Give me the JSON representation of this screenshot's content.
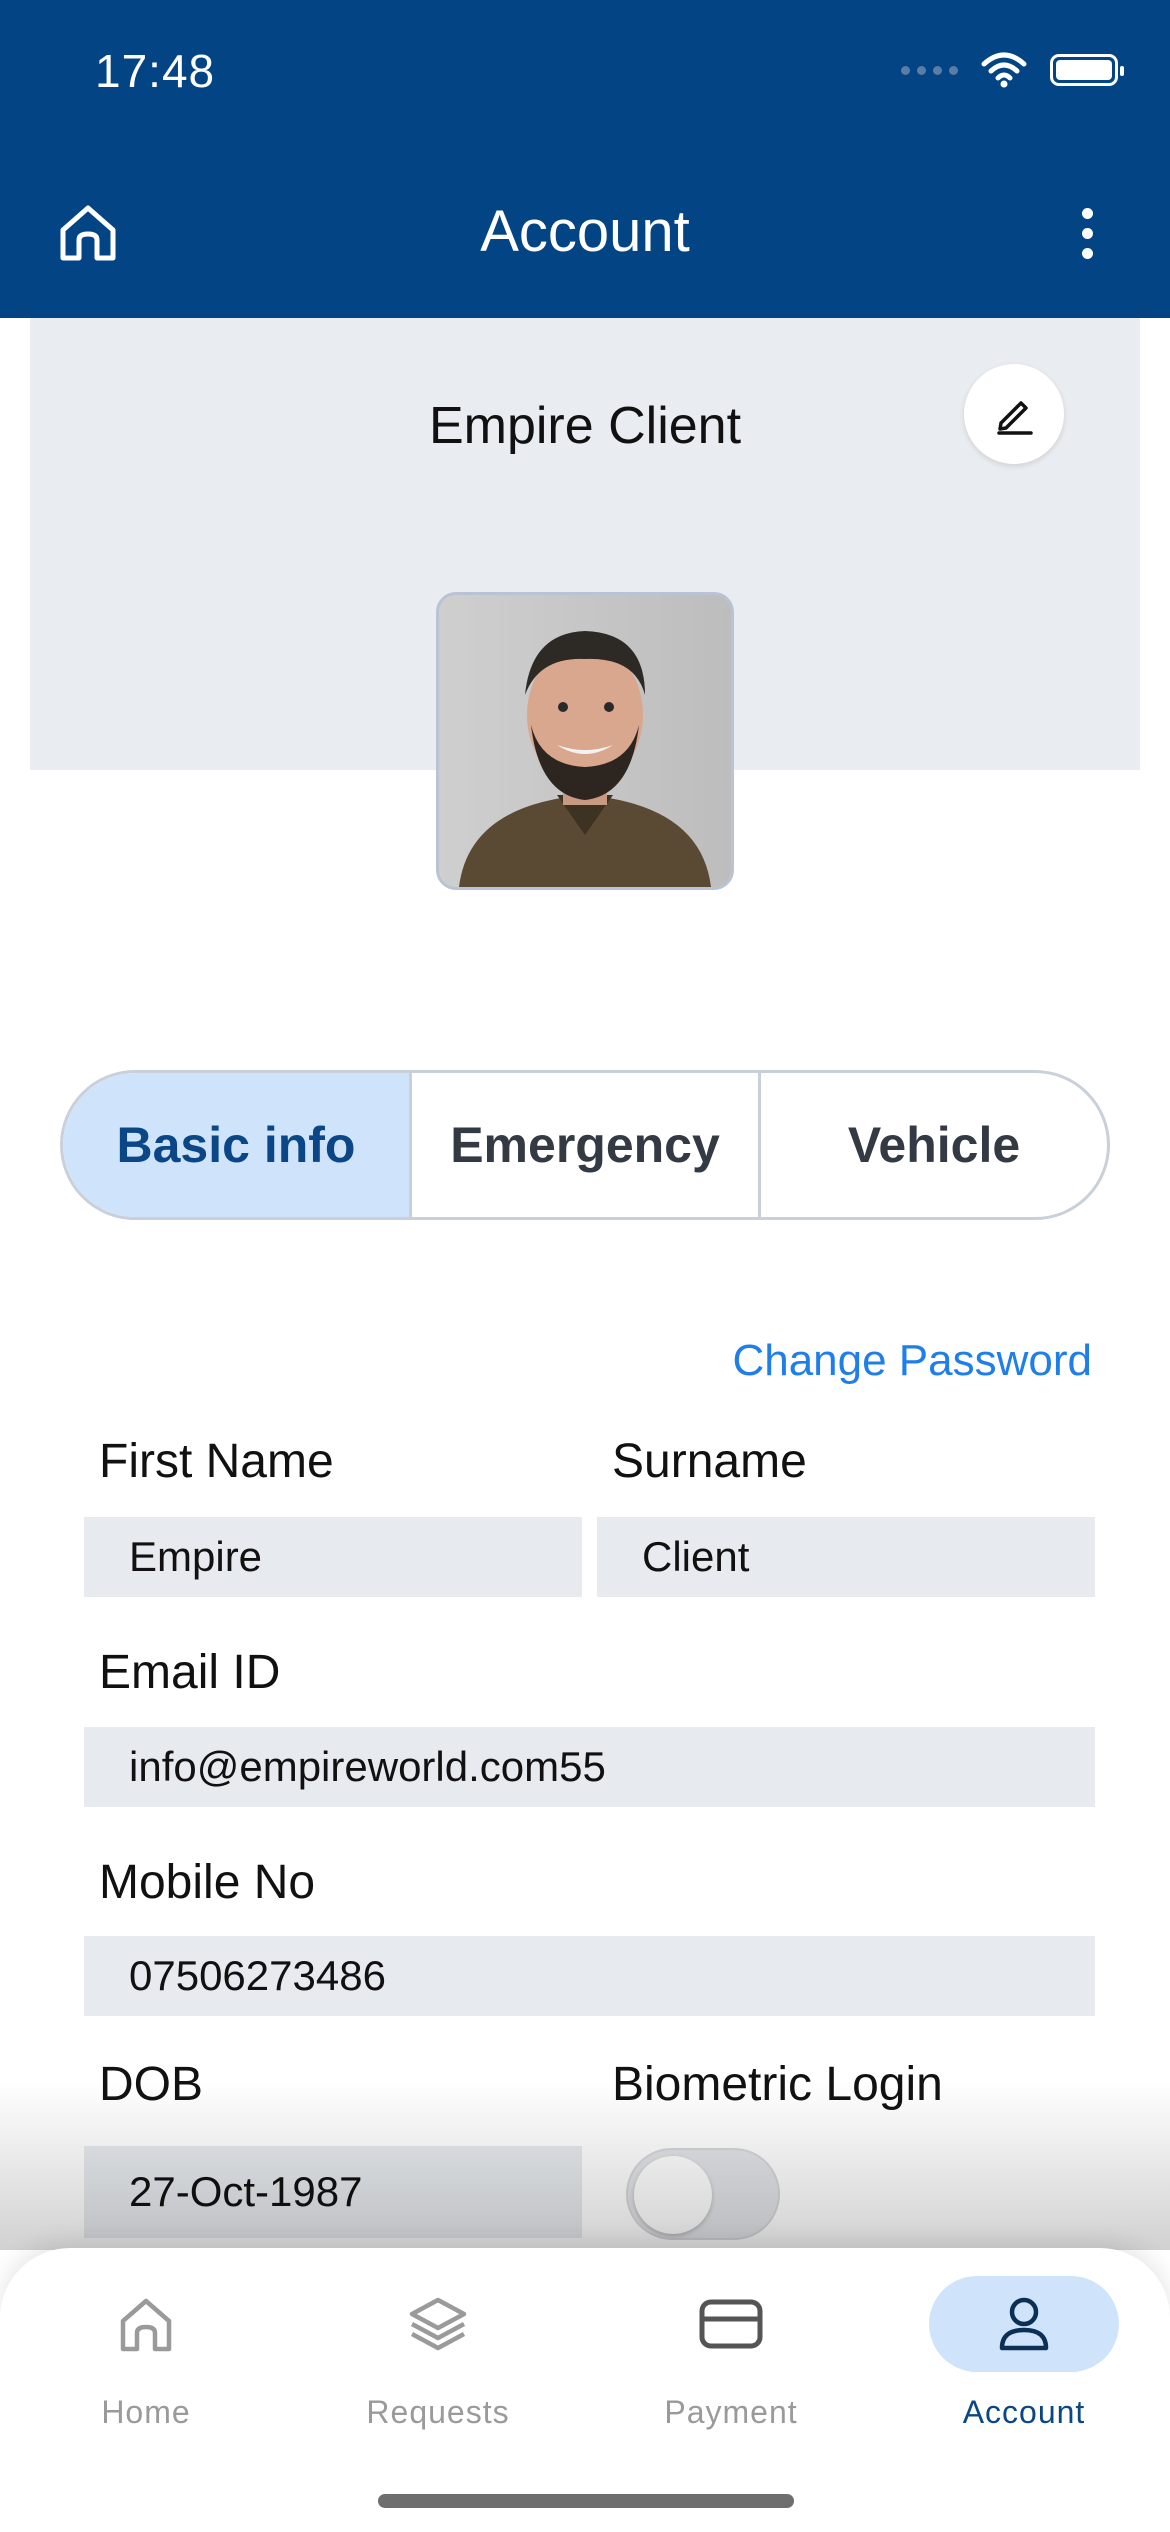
{
  "status_bar": {
    "time": "17:48"
  },
  "app_bar": {
    "title": "Account"
  },
  "profile": {
    "name": "Empire Client"
  },
  "segments": [
    {
      "label": "Basic info",
      "active": true
    },
    {
      "label": "Emergency",
      "active": false
    },
    {
      "label": "Vehicle",
      "active": false
    }
  ],
  "change_password": "Change Password",
  "form": {
    "first_name": {
      "label": "First Name",
      "value": "Empire"
    },
    "surname": {
      "label": "Surname",
      "value": "Client"
    },
    "email": {
      "label": "Email ID",
      "value": "info@empireworld.com55"
    },
    "mobile": {
      "label": "Mobile No",
      "value": "07506273486"
    },
    "dob": {
      "label": "DOB",
      "value": "27-Oct-1987"
    },
    "biometric": {
      "label": "Biometric Login",
      "enabled": false
    }
  },
  "tabs": [
    {
      "label": "Home",
      "icon": "home-icon",
      "active": false
    },
    {
      "label": "Requests",
      "icon": "layers-icon",
      "active": false
    },
    {
      "label": "Payment",
      "icon": "card-icon",
      "active": false
    },
    {
      "label": "Account",
      "icon": "user-icon",
      "active": true
    }
  ],
  "colors": {
    "primary": "#034584",
    "accent": "#1f7ee8",
    "active_bg": "#cfe4fb",
    "field_bg": "#e7eaee"
  }
}
